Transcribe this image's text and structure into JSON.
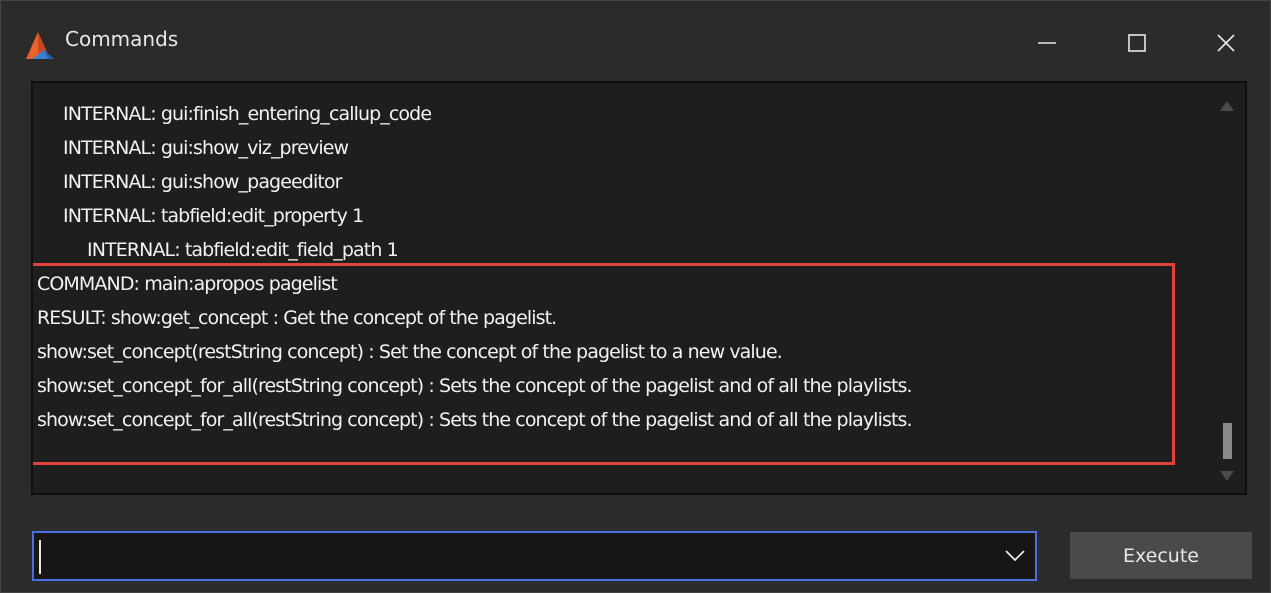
{
  "window": {
    "title": "Commands",
    "icon": "vizrt-app-icon",
    "controls": {
      "minimize": "minimize-icon",
      "maximize": "maximize-icon",
      "close": "close-icon"
    }
  },
  "log": {
    "lines": [
      "INTERNAL: gui:finish_entering_callup_code",
      "INTERNAL: gui:show_viz_preview",
      "INTERNAL: gui:show_pageeditor",
      "INTERNAL: tabfield:edit_property 1",
      "INTERNAL: tabfield:edit_field_path 1",
      "COMMAND: main:apropos pagelist",
      "RESULT: show:get_concept : Get the concept of the pagelist.",
      "show:set_concept(restString concept) : Set the concept of the pagelist to a new value.",
      "show:set_concept_for_all(restString concept) : Sets the concept of the pagelist and of all the playlists.",
      "show:set_concept_for_all(restString concept) : Sets the concept of the pagelist and of all the playlists."
    ],
    "highlight_color": "#e0433a"
  },
  "command_input": {
    "value": "",
    "placeholder": "",
    "focus_color": "#4a6fe0"
  },
  "execute_button": {
    "label": "Execute"
  }
}
